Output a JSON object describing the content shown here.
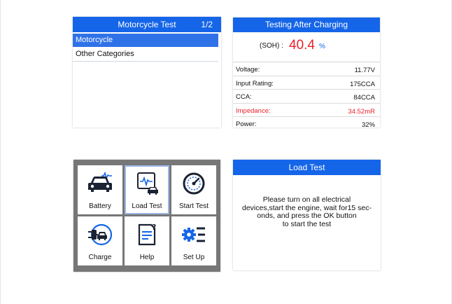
{
  "menu_panel": {
    "title": "Motorcycle Test",
    "page": "1/2",
    "items": [
      {
        "label": "Motorcycle",
        "selected": true
      },
      {
        "label": "Other Categories",
        "selected": false
      }
    ]
  },
  "result_panel": {
    "title": "Testing After Charging",
    "soh_label": "(SOH) :",
    "soh_value": "40.4",
    "soh_unit": "%",
    "rows": [
      {
        "key": "Voltage:",
        "value": "11.77V"
      },
      {
        "key": "Input Rating:",
        "value": "175CCA"
      },
      {
        "key": "CCA:",
        "value": "84CCA"
      },
      {
        "key": "Impedance:",
        "value": "34.52mR",
        "highlight": true
      },
      {
        "key": "Power:",
        "value": "32%"
      }
    ]
  },
  "main_menu": {
    "tiles": [
      {
        "label": "Battery",
        "icon": "car-battery-icon"
      },
      {
        "label": "Load Test",
        "icon": "load-test-icon",
        "selected": true
      },
      {
        "label": "Start Test",
        "icon": "gauge-icon"
      },
      {
        "label": "Charge",
        "icon": "charge-plug-icon"
      },
      {
        "label": "Help",
        "icon": "help-document-icon"
      },
      {
        "label": "Set Up",
        "icon": "gear-settings-icon"
      }
    ]
  },
  "load_test_panel": {
    "title": "Load Test",
    "message": "Please turn on all electrical\ndevices,start the engine, wait for15 sec-\nonds, and press the OK button\nto start the test"
  },
  "colors": {
    "header_blue": "#1565e8",
    "selection_blue": "#2f72e8",
    "value_red": "#e8212a",
    "icon_dark": "#1a2233",
    "icon_blue": "#1565e8"
  }
}
